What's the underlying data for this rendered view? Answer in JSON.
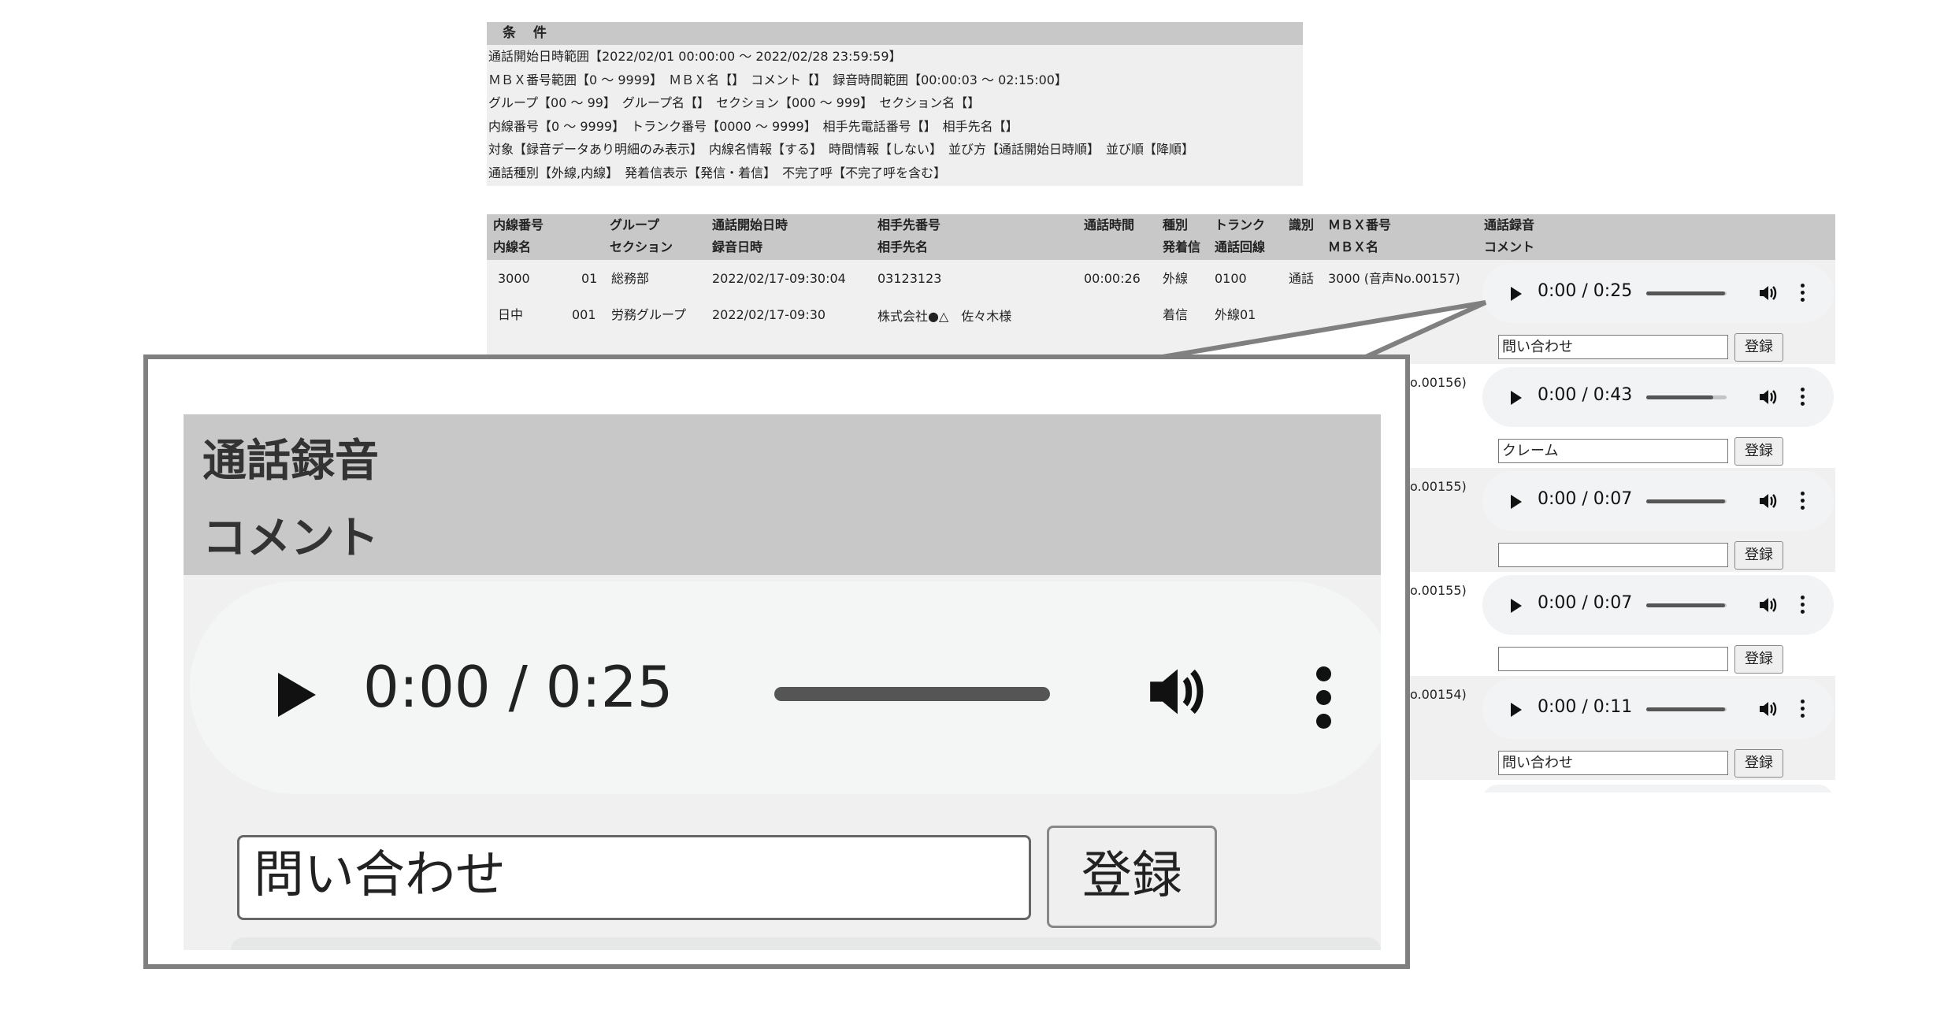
{
  "conditions": {
    "header": "条 件",
    "lines": [
      "通話開始日時範囲【2022/02/01 00:00:00 ～ 2022/02/28 23:59:59】",
      "ＭＢＸ番号範囲【0 ～ 9999】　ＭＢＸ名【】　コメント【】　録音時間範囲【00:00:03 ～ 02:15:00】",
      "グループ【00 ～ 99】　グループ名【】　セクション【000 ～ 999】　セクション名【】",
      "内線番号【0 ～ 9999】　トランク番号【0000 ～ 9999】　相手先電話番号【】　相手先名【】",
      "対象【録音データあり明細のみ表示】　内線名情報【する】　時間情報【しない】　並び方【通話開始日時順】　並び順【降順】",
      "通話種別【外線,内線】　発着信表示【発信・着信】　不完了呼【不完了呼を含む】"
    ]
  },
  "table": {
    "headers": {
      "ext_no": "内線番号",
      "ext_name": "内線名",
      "group": "グループ",
      "section": "セクション",
      "start": "通話開始日時",
      "rec": "録音日時",
      "partner_no": "相手先番号",
      "partner_name": "相手先名",
      "duration": "通話時間",
      "kind": "種別",
      "direction": "発着信",
      "trunk": "トランク",
      "line": "通話回線",
      "ident": "識別",
      "mbx_no": "ＭＢＸ番号",
      "mbx_name": "ＭＢＸ名",
      "recording": "通話録音",
      "comment": "コメント"
    },
    "first_row": {
      "ext_no": "3000",
      "group_no": "01",
      "group_name": "総務部",
      "start": "2022/02/17-09:30:04",
      "partner_no": "03123123",
      "duration": "00:00:26",
      "kind": "外線",
      "trunk": "0100",
      "ident": "通話",
      "mbx": "3000 (音声No.00157)",
      "ext_name": "日中",
      "section_no": "001",
      "section_name": "労務グループ",
      "rec": "2022/02/17-09:30",
      "partner_name": "株式会社●△　佐々木様",
      "direction": "着信",
      "line": "外線01"
    },
    "mbx_partials": [
      "o.00156)",
      "o.00155)",
      "o.00155)",
      "o.00154)"
    ],
    "players": [
      {
        "time": "0:00 / 0:25",
        "comment": "問い合わせ"
      },
      {
        "time": "0:00 / 0:43",
        "comment": "クレーム"
      },
      {
        "time": "0:00 / 0:07",
        "comment": ""
      },
      {
        "time": "0:00 / 0:07",
        "comment": ""
      },
      {
        "time": "0:00 / 0:11",
        "comment": "問い合わせ"
      }
    ],
    "register_label": "登録"
  },
  "zoom": {
    "header_recording": "通話録音",
    "header_comment": "コメント",
    "player_time": "0:00 / 0:25",
    "comment_value": "問い合わせ",
    "register_label": "登録"
  }
}
